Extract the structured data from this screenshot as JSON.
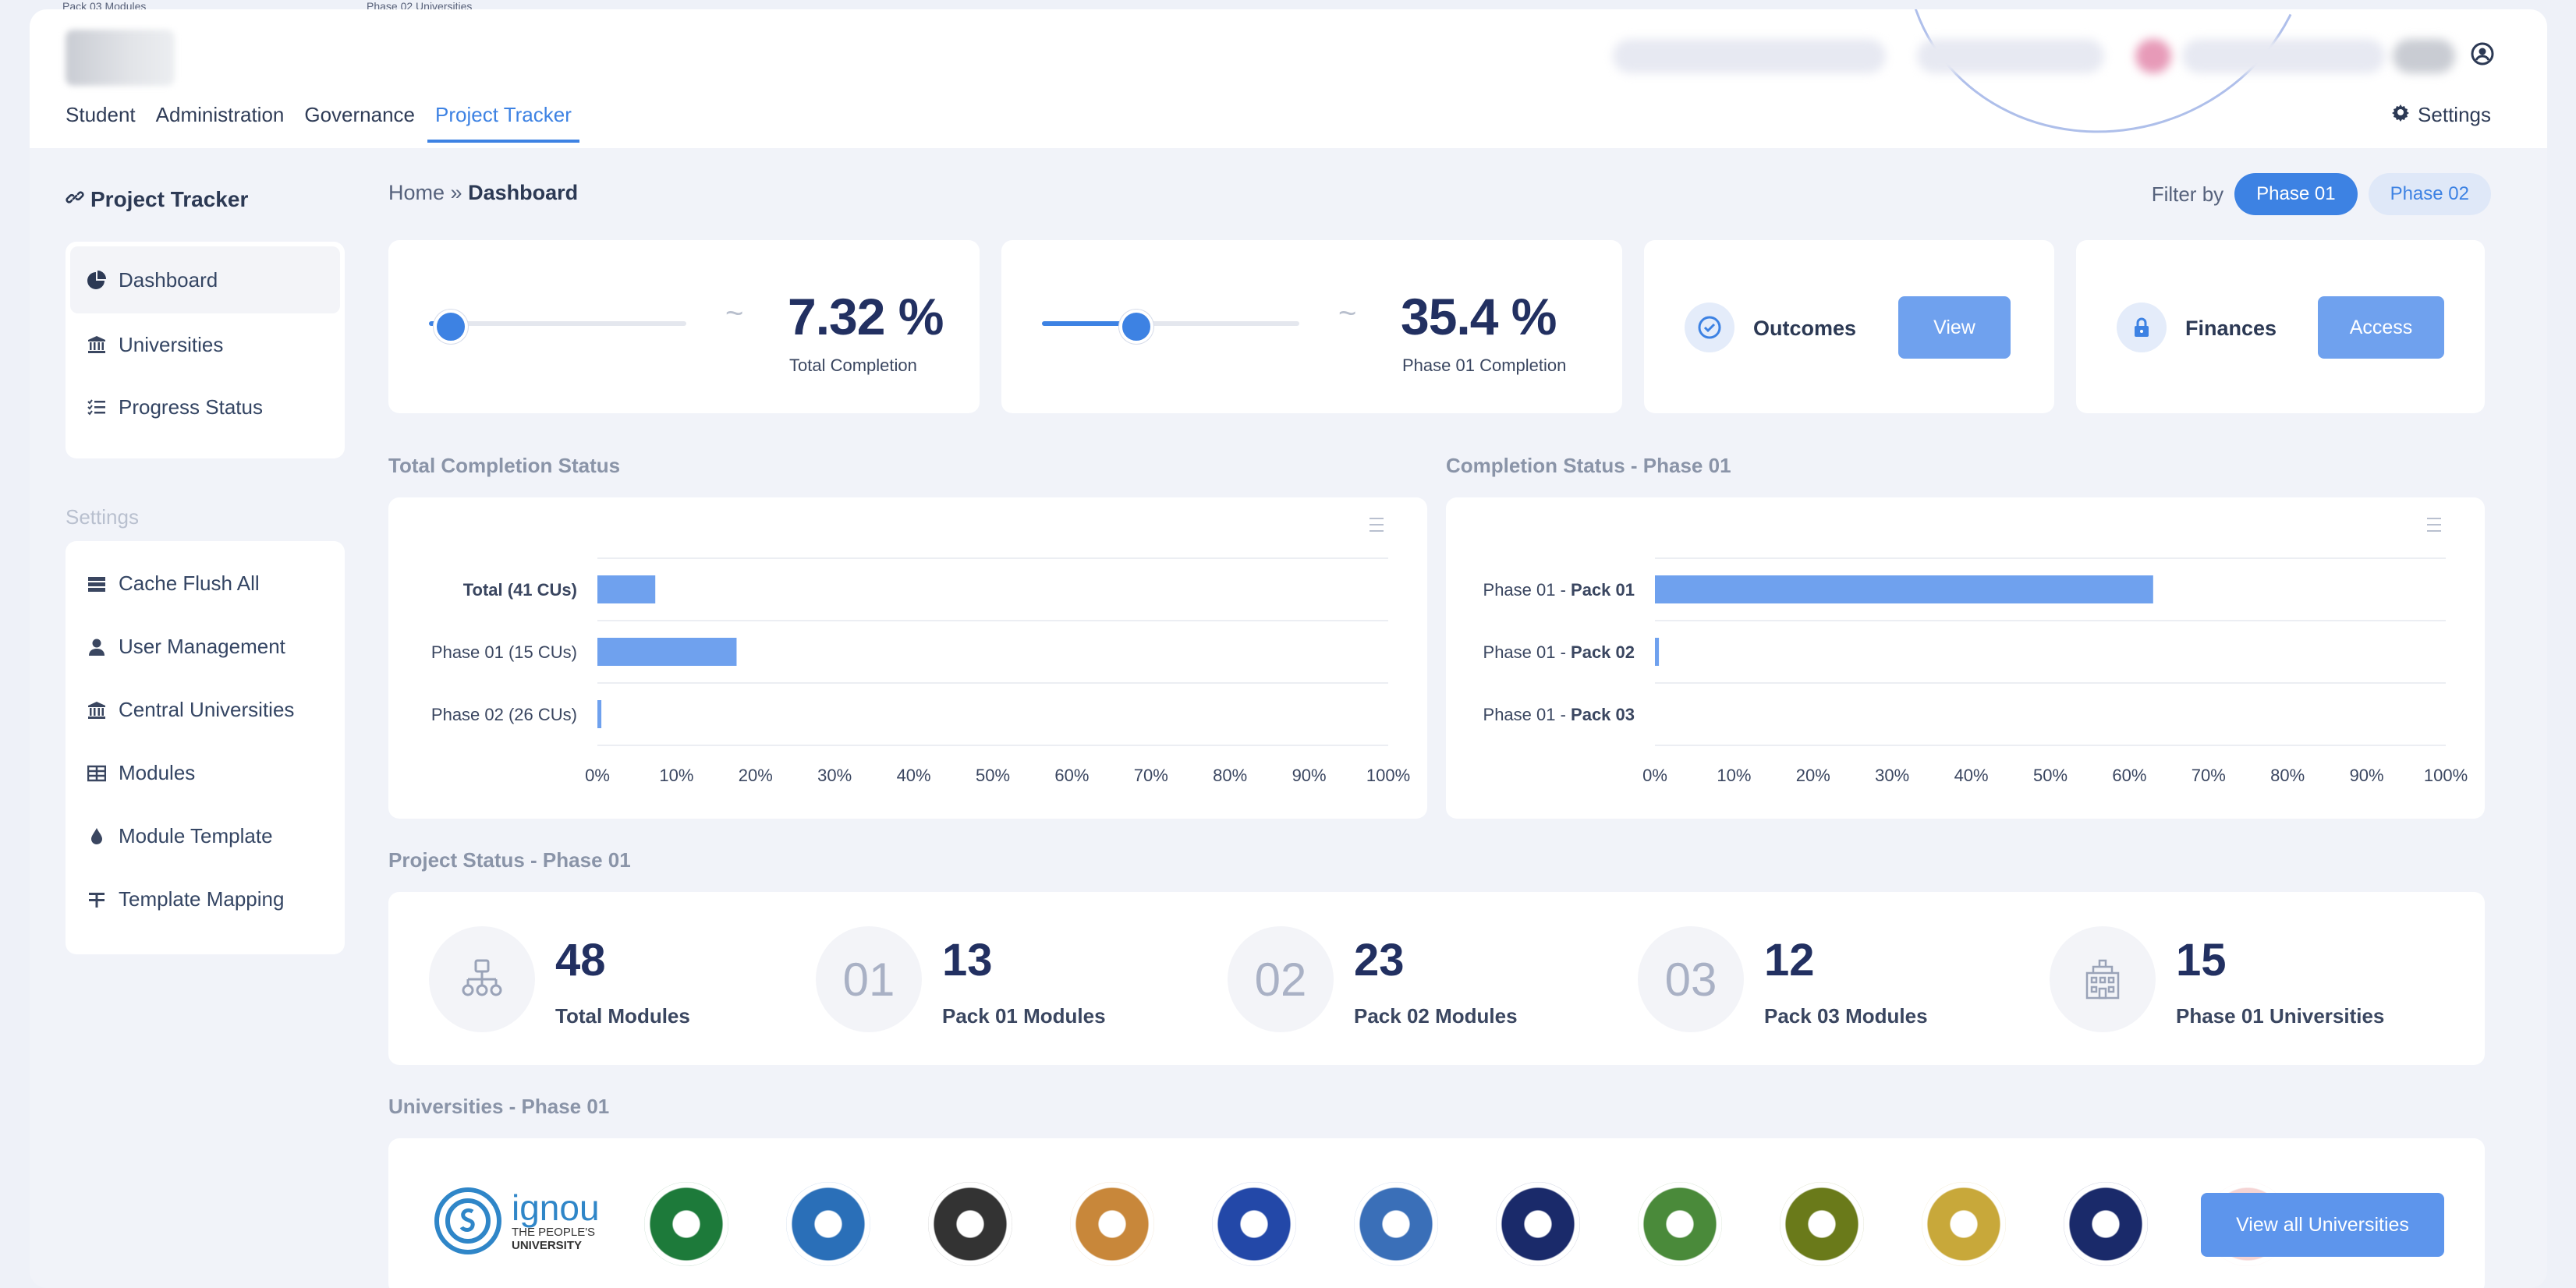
{
  "ghost_top": {
    "left_label": "Pack 03 Modules",
    "right_label": "Phase 02 Universities"
  },
  "nav": {
    "items": [
      "Student",
      "Administration",
      "Governance",
      "Project Tracker"
    ],
    "active": "Project Tracker",
    "settings_label": "Settings"
  },
  "sidebar": {
    "title": "Project Tracker",
    "menu": [
      {
        "label": "Dashboard",
        "icon": "pie-chart-icon",
        "active": true
      },
      {
        "label": "Universities",
        "icon": "institution-icon"
      },
      {
        "label": "Progress Status",
        "icon": "checklist-icon"
      }
    ],
    "settings_heading": "Settings",
    "settings_menu": [
      {
        "label": "Cache Flush All",
        "icon": "server-icon"
      },
      {
        "label": "User Management",
        "icon": "user-icon"
      },
      {
        "label": "Central Universities",
        "icon": "institution-icon"
      },
      {
        "label": "Modules",
        "icon": "table-icon"
      },
      {
        "label": "Module Template",
        "icon": "drop-icon"
      },
      {
        "label": "Template Mapping",
        "icon": "mapping-icon"
      }
    ]
  },
  "breadcrumb": {
    "home": "Home",
    "separator": "»",
    "current": "Dashboard"
  },
  "filter": {
    "label": "Filter by",
    "options": [
      "Phase 01",
      "Phase 02"
    ],
    "selected": "Phase 01"
  },
  "kpis": [
    {
      "value": "7.32 %",
      "label": "Total Completion",
      "slider_fraction": 0.0732
    },
    {
      "value": "35.4 %",
      "label": "Phase 01 Completion",
      "slider_fraction": 0.354
    }
  ],
  "actions": [
    {
      "label": "Outcomes",
      "button": "View",
      "icon": "check-circle-icon"
    },
    {
      "label": "Finances",
      "button": "Access",
      "icon": "lock-icon"
    }
  ],
  "sections": {
    "total_completion": "Total Completion Status",
    "phase_completion": "Completion Status - Phase 01",
    "project_status": "Project Status - Phase 01",
    "universities": "Universities - Phase 01"
  },
  "chart_data": [
    {
      "type": "bar",
      "orientation": "horizontal",
      "title": "Total Completion Status",
      "categories": [
        "Total (41 CUs)",
        "Phase 01 (15 CUs)",
        "Phase 02 (26 CUs)"
      ],
      "values": [
        7.32,
        17.6,
        0.5
      ],
      "xlim": [
        0,
        100
      ],
      "ticks": [
        "0%",
        "10%",
        "20%",
        "30%",
        "40%",
        "50%",
        "60%",
        "70%",
        "80%",
        "90%",
        "100%"
      ],
      "color": "#6fa1ee",
      "grid": true
    },
    {
      "type": "bar",
      "orientation": "horizontal",
      "title": "Completion Status - Phase 01",
      "categories": [
        {
          "prefix": "Phase 01 - ",
          "bold": "Pack 01"
        },
        {
          "prefix": "Phase 01 - ",
          "bold": "Pack 02"
        },
        {
          "prefix": "Phase 01 - ",
          "bold": "Pack 03"
        }
      ],
      "values": [
        63,
        0.5,
        0
      ],
      "xlim": [
        0,
        100
      ],
      "ticks": [
        "0%",
        "10%",
        "20%",
        "30%",
        "40%",
        "50%",
        "60%",
        "70%",
        "80%",
        "90%",
        "100%"
      ],
      "color": "#6fa1ee",
      "grid": true
    }
  ],
  "project_status": [
    {
      "badge": "",
      "icon": "org-chart-icon",
      "value": "48",
      "label": "Total Modules"
    },
    {
      "badge": "01",
      "value": "13",
      "label": "Pack 01 Modules"
    },
    {
      "badge": "02",
      "value": "23",
      "label": "Pack 02 Modules"
    },
    {
      "badge": "03",
      "value": "12",
      "label": "Pack 03 Modules"
    },
    {
      "badge": "",
      "icon": "building-icon",
      "value": "15",
      "label": "Phase 01 Universities"
    }
  ],
  "universities": {
    "ignou": {
      "name": "ignou",
      "tagline_1": "THE PEOPLE'S",
      "tagline_2": "UNIVERSITY"
    },
    "logo_colors": [
      "#1d7a3a",
      "#2a6fb8",
      "#333333",
      "#c8873a",
      "#2348a8",
      "#3a6fb8",
      "#1a2a6a",
      "#4a8a3a",
      "#6a7a1a",
      "#c8a83a",
      "#1a2a6a",
      "#e8a0a0"
    ],
    "view_all_label": "View all Universities"
  }
}
